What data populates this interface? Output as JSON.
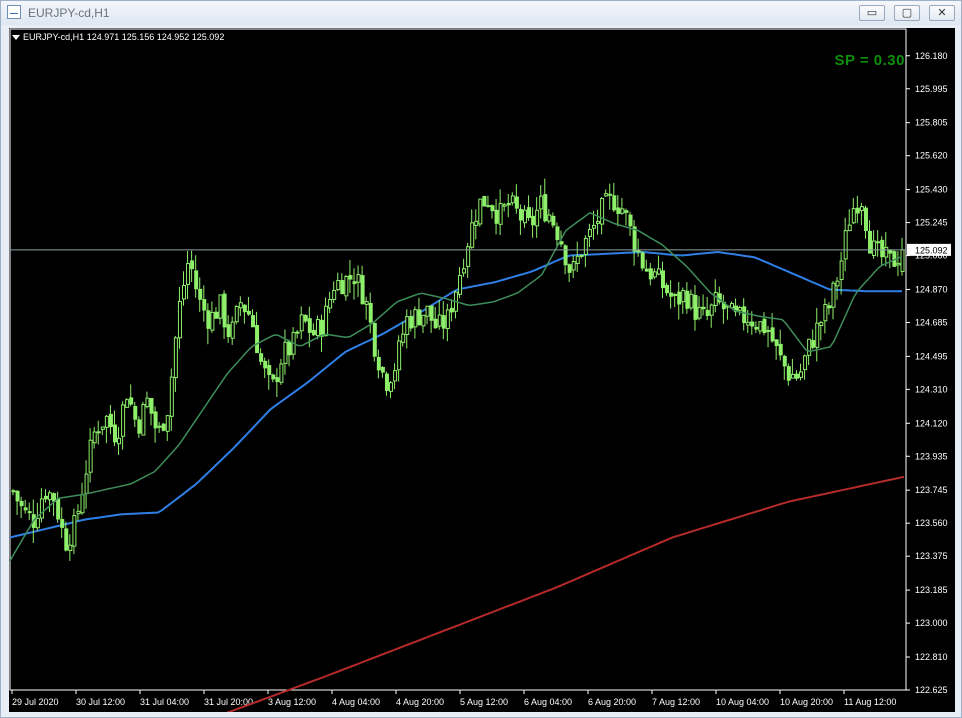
{
  "window": {
    "title": "EURJPY-cd,H1",
    "buttons": {
      "minimize": "▭",
      "restore": "▢",
      "close": "✕"
    }
  },
  "chart": {
    "symbol_line": "EURJPY-cd,H1  124.971 125.156 124.952 125.092",
    "spread_label": "SP = 0.30",
    "current_price_label": "125.092",
    "colors": {
      "background": "#000000",
      "candle": "#8ef06a",
      "ma_fast": "#3e8d5a",
      "ma_medium": "#2f7fe6",
      "ma_slow": "#b52a2a",
      "bid_line": "#8aa3a0"
    }
  },
  "chart_data": {
    "type": "candlestick",
    "symbol": "EURJPY-cd",
    "timeframe": "H1",
    "last_bar": {
      "open": 124.971,
      "high": 125.156,
      "low": 124.952,
      "close": 125.092
    },
    "current_price": 125.092,
    "y_ticks": [
      "126.180",
      "125.995",
      "125.805",
      "125.620",
      "125.430",
      "125.245",
      "125.060",
      "124.870",
      "124.685",
      "124.495",
      "124.310",
      "124.120",
      "123.935",
      "123.745",
      "123.560",
      "123.375",
      "123.185",
      "123.000",
      "122.810",
      "122.625"
    ],
    "x_ticks": [
      "29 Jul 2020",
      "30 Jul 12:00",
      "31 Jul 04:00",
      "31 Jul 20:00",
      "3 Aug 12:00",
      "4 Aug 04:00",
      "4 Aug 20:00",
      "5 Aug 12:00",
      "6 Aug 04:00",
      "6 Aug 20:00",
      "7 Aug 12:00",
      "10 Aug 04:00",
      "10 Aug 20:00",
      "11 Aug 12:00"
    ],
    "ylim": [
      122.625,
      126.33
    ],
    "anchors": {
      "close": [
        123.74,
        123.62,
        123.58,
        123.75,
        123.7,
        123.45,
        123.55,
        123.85,
        124.1,
        124.15,
        124.05,
        124.3,
        124.1,
        124.25,
        124.05,
        124.22,
        124.75,
        125.05,
        124.8,
        124.7,
        124.78,
        124.6,
        124.8,
        124.72,
        124.45,
        124.3,
        124.5,
        124.55,
        124.7,
        124.62,
        124.68,
        124.9,
        124.92,
        124.95,
        124.83,
        124.55,
        124.35,
        124.45,
        124.7,
        124.72,
        124.75,
        124.65,
        124.7,
        124.92,
        125.15,
        125.35,
        125.38,
        125.28,
        125.35,
        125.28,
        125.22,
        125.35,
        125.28,
        125.15,
        124.95,
        125.1,
        125.2,
        125.32,
        125.38,
        125.32,
        125.15,
        125.0,
        124.95,
        124.88,
        124.8,
        124.85,
        124.75,
        124.7,
        124.8,
        124.75,
        124.7,
        124.72,
        124.68,
        124.65,
        124.5,
        124.4,
        124.38,
        124.55,
        124.68,
        124.78,
        125.0,
        125.3,
        125.4,
        125.1,
        125.05,
        125.02,
        125.09
      ],
      "ma_fast": [
        123.35,
        123.58,
        123.7,
        123.72,
        123.75,
        123.78,
        123.85,
        124.0,
        124.2,
        124.4,
        124.55,
        124.62,
        124.55,
        124.62,
        124.6,
        124.68,
        124.8,
        124.85,
        124.82,
        124.78,
        124.8,
        124.85,
        124.95,
        125.2,
        125.3,
        125.24,
        125.2,
        125.12,
        125.0,
        124.85,
        124.75,
        124.72,
        124.7,
        124.52,
        124.55,
        124.85,
        125.0,
        125.06
      ],
      "ma_medium": [
        123.48,
        123.53,
        123.58,
        123.61,
        123.62,
        123.78,
        123.98,
        124.2,
        124.35,
        124.52,
        124.62,
        124.74,
        124.87,
        124.91,
        124.97,
        125.06,
        125.07,
        125.08,
        125.06,
        125.08,
        125.05,
        124.96,
        124.87,
        124.86,
        124.86
      ],
      "ma_slow": [
        122.46,
        122.7,
        122.95,
        123.2,
        123.48,
        123.68,
        123.82
      ]
    }
  }
}
